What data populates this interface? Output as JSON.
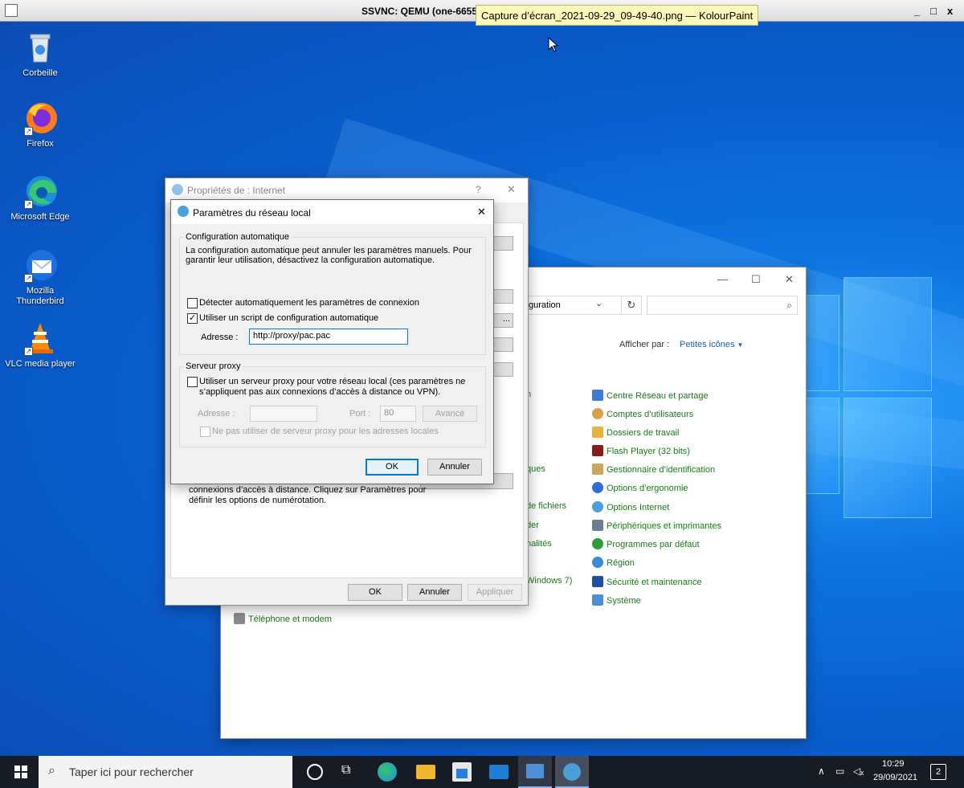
{
  "vnc": {
    "title": "SSVNC: QEMU (one-66555",
    "tooltip": "Capture d’écran_2021-09-29_09-49-40.png — KolourPaint",
    "controls": [
      "_",
      "□",
      "x"
    ]
  },
  "desktop": {
    "icons": [
      {
        "label": "Corbeille",
        "icon": "recycle-bin-icon"
      },
      {
        "label": "Firefox",
        "icon": "firefox-icon"
      },
      {
        "label": "Microsoft Edge",
        "icon": "edge-icon"
      },
      {
        "label_line1": "Mozilla",
        "label_line2": "Thunderbird",
        "icon": "thunderbird-icon"
      },
      {
        "label": "VLC media player",
        "icon": "vlc-icon"
      }
    ]
  },
  "control_panel": {
    "address_fragment": "guration",
    "view_by_label": "Afficher par :",
    "view_by_value": "Petites icônes",
    "left_fragments": [
      "n",
      "ques",
      "de fichiers",
      "der",
      "nalités",
      "Windows 7)"
    ],
    "items": [
      "Centre Réseau et partage",
      "Comptes d’utilisateurs",
      "Dossiers de travail",
      "Flash Player (32 bits)",
      "Gestionnaire d’identification",
      "Options d’ergonomie",
      "Options Internet",
      "Périphériques et imprimantes",
      "Programmes par défaut",
      "Région",
      "Sécurité et maintenance",
      "Système"
    ],
    "bottom_item": "Téléphone et modem"
  },
  "internet_properties": {
    "title": "Propriétés de : Internet",
    "help": "?",
    "close": "✕",
    "dialup_text_line1": "connexions d’accès à distance. Cliquez sur Paramètres pour",
    "dialup_text_line2": "définir les options de numérotation.",
    "ok": "OK",
    "cancel": "Annuler",
    "apply": "Appliquer",
    "side_button_fragment": "..."
  },
  "lan_dialog": {
    "title": "Paramètres du réseau local",
    "close": "✕",
    "auto_config": {
      "legend": "Configuration automatique",
      "desc_line1": "La configuration automatique peut annuler les paramètres manuels. Pour",
      "desc_line2": "garantir leur utilisation, désactivez la configuration automatique.",
      "detect_label": "Détecter automatiquement les paramètres de connexion",
      "detect_checked": false,
      "script_label": "Utiliser un script de configuration automatique",
      "script_checked": true,
      "address_label": "Adresse :",
      "address_value": "http://proxy/pac.pac"
    },
    "proxy": {
      "legend": "Serveur proxy",
      "use_proxy_line1": "Utiliser un serveur proxy pour votre réseau local (ces paramètres ne",
      "use_proxy_line2": "s’appliquent pas aux connexions d’accès à distance ou VPN).",
      "use_proxy_checked": false,
      "address_label": "Adresse :",
      "address_value": "",
      "port_label": "Port :",
      "port_value": "80",
      "advanced": "Avancé",
      "bypass_label": "Ne pas utiliser de serveur proxy pour les adresses locales",
      "bypass_checked": false
    },
    "ok": "OK",
    "cancel": "Annuler"
  },
  "taskbar": {
    "search_placeholder": "Taper ici pour rechercher",
    "time": "10:29",
    "date": "29/09/2021",
    "notification_count": "2"
  }
}
